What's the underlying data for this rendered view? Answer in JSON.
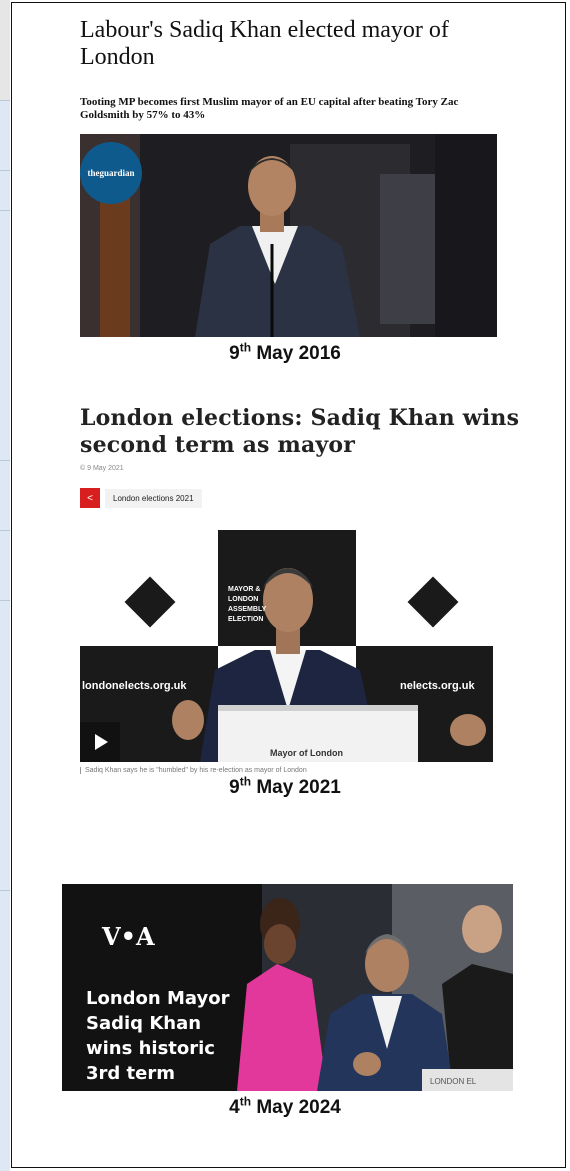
{
  "article1": {
    "headline": "Labour's Sadiq Khan elected mayor of London",
    "standfirst": "Tooting MP becomes first Muslim mayor of an EU capital after beating Tory Zac Goldsmith by 57% to 43%",
    "logo": "theguardian",
    "date_day": "9",
    "date_suffix": "th",
    "date_rest": "May 2016"
  },
  "article2": {
    "headline": "London elections: Sadiq Khan wins second term as mayor",
    "date_meta": "© 9 May 2021",
    "share_icon": "share-icon",
    "tag": "London elections 2021",
    "backdrop_left": "londonelects.org.uk",
    "backdrop_right": "nelects.org.uk",
    "backdrop_mid": "MAYOR & LONDON ASSEMBLY ELECTION",
    "lectern": "Mayor of London",
    "caption": "Sadiq Khan says he is \"humbled\" by his re-election as mayor of London",
    "date_day": "9",
    "date_suffix": "th",
    "date_rest": "May 2021"
  },
  "article3": {
    "logo": "V•A",
    "title": "London Mayor Sadiq Khan wins historic 3rd term",
    "lectern": "LONDON EL",
    "date_day": "4",
    "date_suffix": "th",
    "date_rest": "May 2024"
  },
  "colors": {
    "guardian_blue": "#0f5a8c",
    "bbc_red": "#d81e1e",
    "voa_dark": "#141414"
  }
}
